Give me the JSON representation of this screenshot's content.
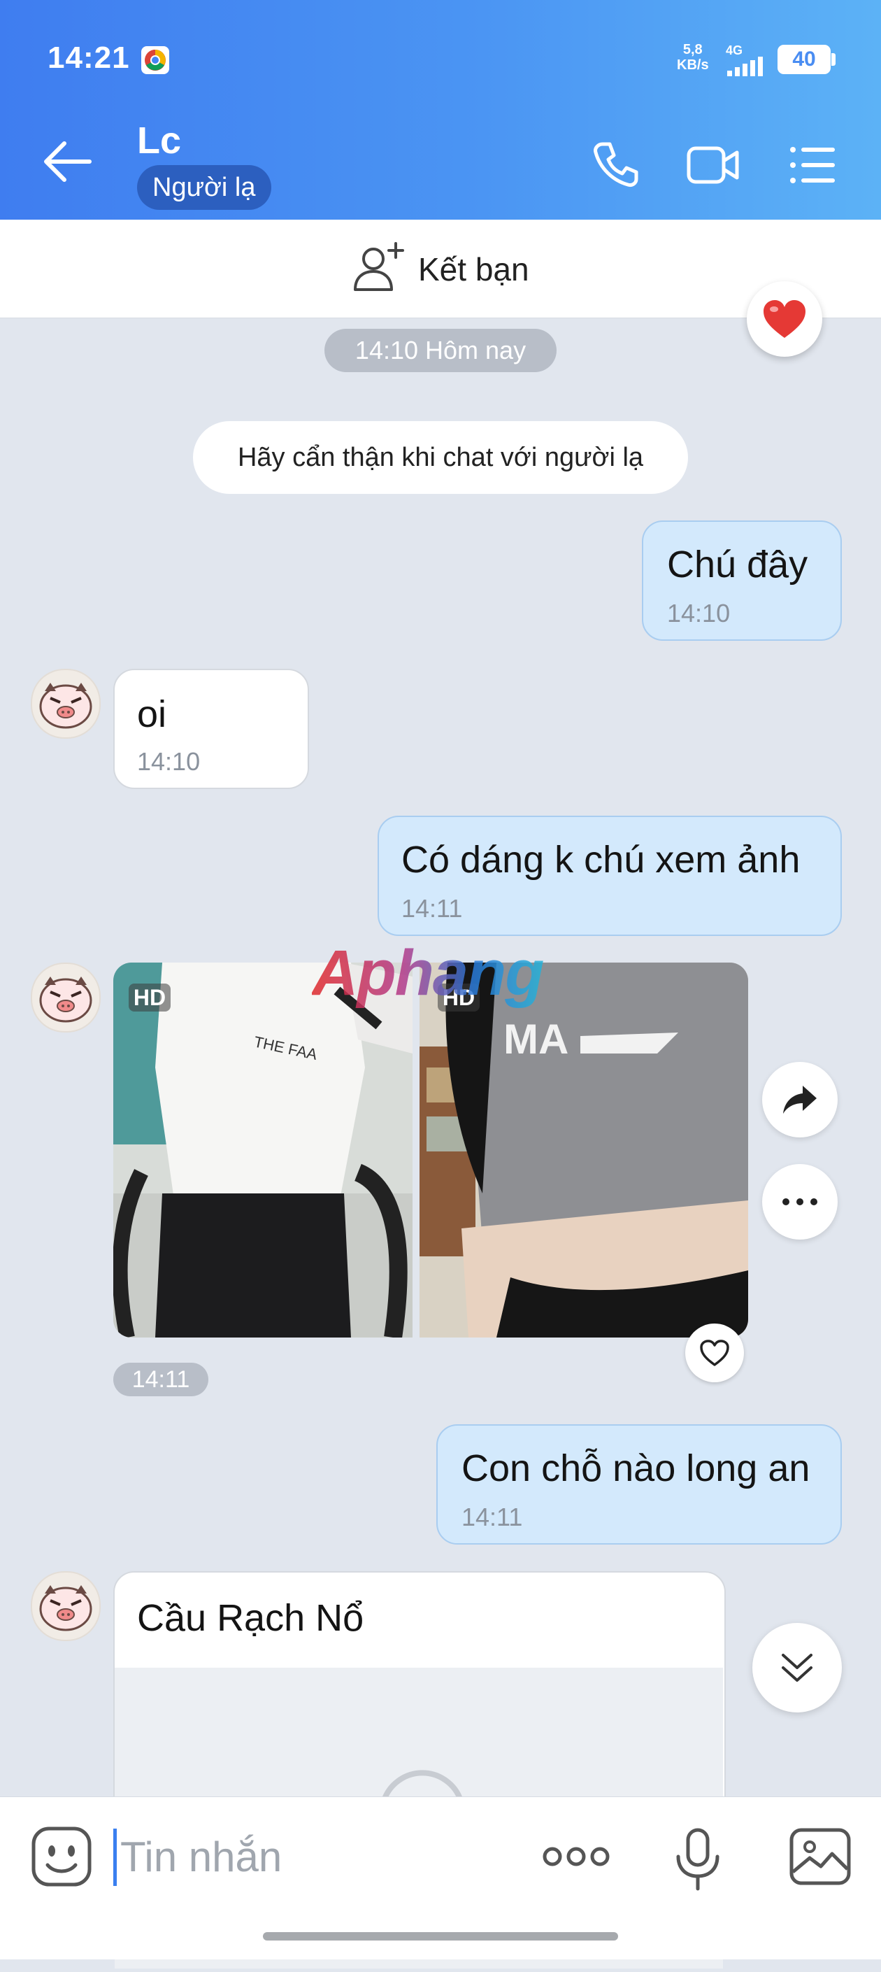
{
  "status_bar": {
    "time": "14:21",
    "net_speed_value": "5,8",
    "net_speed_unit": "KB/s",
    "network_type": "4G",
    "battery": "40"
  },
  "header": {
    "contact_name": "Lc",
    "badge": "Người lạ"
  },
  "add_friend": {
    "label": "Kết bạn"
  },
  "chat": {
    "date_divider": "14:10 Hôm nay",
    "warning": "Hãy cẩn thận khi chat với người lạ",
    "messages": [
      {
        "text": "Chú đây",
        "time": "14:10"
      },
      {
        "text": "oi",
        "time": "14:10"
      },
      {
        "text": "Có dáng k chú xem ảnh",
        "time": "14:11"
      },
      {
        "photo_time": "14:11",
        "hd_label": "HD"
      },
      {
        "text": "Con chỗ nào long an",
        "time": "14:11"
      },
      {
        "location_title": "Cầu Rạch Nổ"
      }
    ],
    "watermark": "Aphang"
  },
  "input": {
    "placeholder": "Tin nhắn"
  },
  "colors": {
    "header_start": "#3f7df0",
    "header_end": "#5cb2f6",
    "outgoing_bubble": "#d3e9fc",
    "incoming_bubble": "#ffffff",
    "chat_background": "#e1e6ee"
  },
  "icons": [
    "back-arrow-icon",
    "phone-icon",
    "video-call-icon",
    "menu-list-icon",
    "add-friend-icon",
    "heart-icon",
    "forward-icon",
    "more-dots-icon",
    "chevron-double-down-icon",
    "sticker-icon",
    "mic-icon",
    "image-icon"
  ]
}
